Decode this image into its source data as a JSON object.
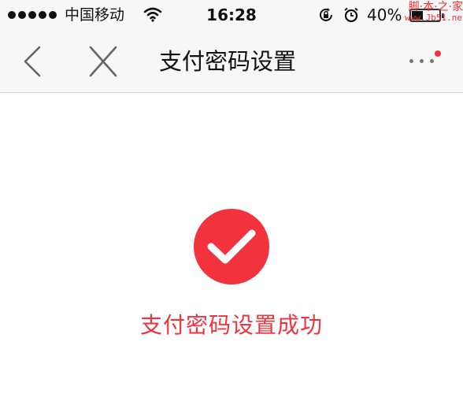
{
  "status_bar": {
    "carrier": "中国移动",
    "time": "16:28",
    "battery_percent": "40%",
    "battery_level": 0.4,
    "icons": [
      "signal-dots-icon",
      "wifi-icon",
      "rotation-lock-icon",
      "alarm-icon",
      "battery-icon"
    ]
  },
  "watermark": {
    "line1": "脚·本·之·家",
    "line2": "www.Jb51.net"
  },
  "nav": {
    "title": "支付密码设置",
    "icons": [
      "back-chevron-icon",
      "close-x-icon",
      "more-dots-icon"
    ]
  },
  "content": {
    "message": "支付密码设置成功",
    "icon": "check-circle-icon"
  },
  "colors": {
    "accent": "#f2333d",
    "bar_bg": "#f7f7f7",
    "text": "#111111"
  }
}
